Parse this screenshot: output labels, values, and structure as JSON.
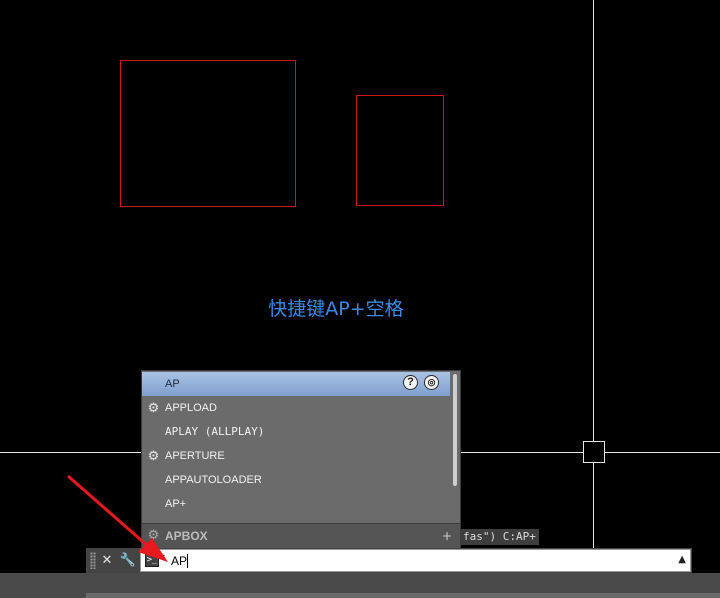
{
  "drawing": {
    "annotation_text": "快捷键AP+空格"
  },
  "autocomplete": {
    "items": [
      {
        "label": "AP",
        "icon": "none",
        "selected": true
      },
      {
        "label": "APPLOAD",
        "icon": "app-load-icon"
      },
      {
        "label": "APLAY (ALLPLAY)",
        "icon": "none"
      },
      {
        "label": "APERTURE",
        "icon": "gear-icon"
      },
      {
        "label": "APPAUTOLOADER",
        "icon": "none"
      },
      {
        "label": "AP+",
        "icon": "none"
      }
    ],
    "last_item": {
      "label": "APBOX",
      "icon": "gear-icon",
      "expand": "+"
    },
    "help_icon": "question-icon",
    "search_icon": "internet-search-icon"
  },
  "history": {
    "text": "fas\") C:AP+"
  },
  "command_line": {
    "value": "AP",
    "prompt_icon": ">_",
    "close_icon": "✕",
    "customize_icon": "wrench-icon",
    "history_arrow": "▲"
  },
  "colors": {
    "rectangle": "#d0141e",
    "crosshair": "#e8e8e8",
    "annotation": "#3d8ae6",
    "selection": "#8fadd6",
    "arrow": "#e8191e"
  }
}
